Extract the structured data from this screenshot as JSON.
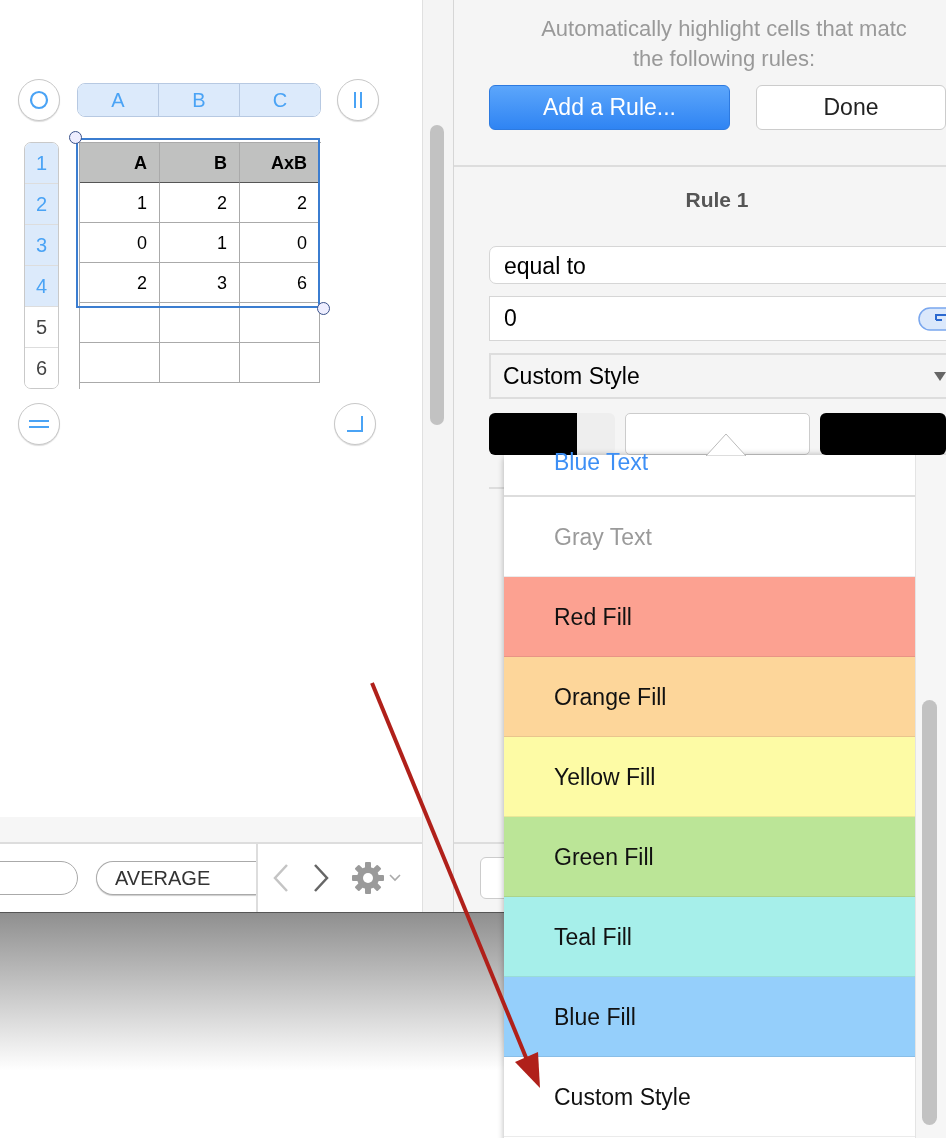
{
  "sheet": {
    "columns": [
      {
        "label": "A",
        "selected": true
      },
      {
        "label": "B",
        "selected": true
      },
      {
        "label": "C",
        "selected": true
      }
    ],
    "rows": [
      {
        "label": "1",
        "selected": true
      },
      {
        "label": "2",
        "selected": true
      },
      {
        "label": "3",
        "selected": true
      },
      {
        "label": "4",
        "selected": true
      },
      {
        "label": "5",
        "selected": false
      },
      {
        "label": "6",
        "selected": false
      }
    ],
    "table": {
      "header": [
        "A",
        "B",
        "AxB"
      ],
      "rows": [
        [
          "1",
          "2",
          "2"
        ],
        [
          "0",
          "1",
          "0"
        ],
        [
          "2",
          "3",
          "6"
        ]
      ]
    }
  },
  "toolbar": {
    "function_button": "AVERAGE"
  },
  "panel": {
    "intro": [
      "Automatically highlight cells that matc",
      "the following rules:"
    ],
    "add_button": "Add a Rule...",
    "done_button": "Done",
    "rule_title": "Rule 1",
    "condition": "equal to",
    "value": "0",
    "style": "Custom Style"
  },
  "style_menu": [
    {
      "label": "Blue Text",
      "kind": "text",
      "color": "#3d8ff5"
    },
    {
      "label": "Gray Text",
      "kind": "text",
      "color": "#9a9a9a"
    },
    {
      "label": "Red Fill",
      "kind": "fill",
      "color": "#fca191"
    },
    {
      "label": "Orange Fill",
      "kind": "fill",
      "color": "#fdd69a"
    },
    {
      "label": "Yellow Fill",
      "kind": "fill",
      "color": "#fdfba5"
    },
    {
      "label": "Green Fill",
      "kind": "fill",
      "color": "#bbe597"
    },
    {
      "label": "Teal Fill",
      "kind": "fill",
      "color": "#a6efea"
    },
    {
      "label": "Blue Fill",
      "kind": "fill",
      "color": "#95cffb"
    },
    {
      "label": "Custom Style",
      "kind": "plain"
    }
  ]
}
